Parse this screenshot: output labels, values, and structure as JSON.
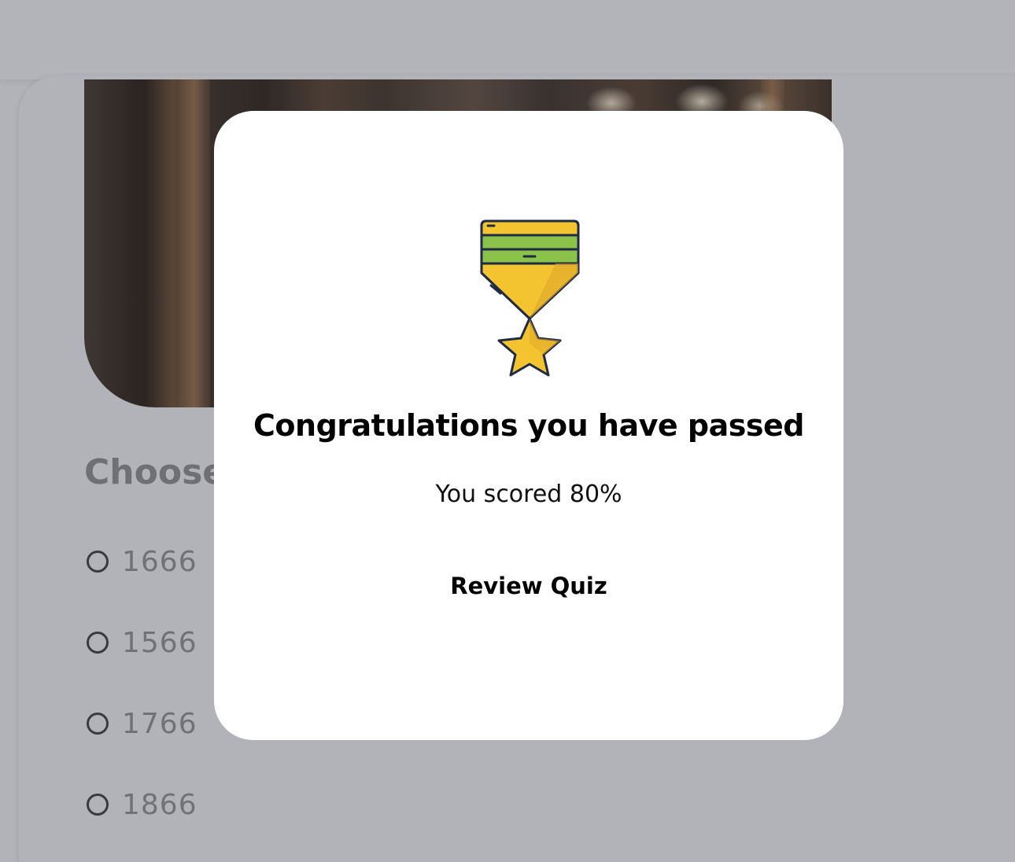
{
  "background": {
    "question_text": "Choose",
    "options": [
      {
        "label": "1666"
      },
      {
        "label": "1566"
      },
      {
        "label": "1766"
      },
      {
        "label": "1866"
      }
    ]
  },
  "modal": {
    "icon": "medal-icon",
    "title": "Congratulations you have passed",
    "score_text": "You scored 80%",
    "review_button_label": "Review Quiz"
  },
  "colors": {
    "overlay": "#b1b3b8",
    "modal_background": "#ffffff",
    "medal_ribbon_green": "#8bc34a",
    "medal_gold": "#f4c430",
    "medal_outline": "#1f2a44"
  }
}
